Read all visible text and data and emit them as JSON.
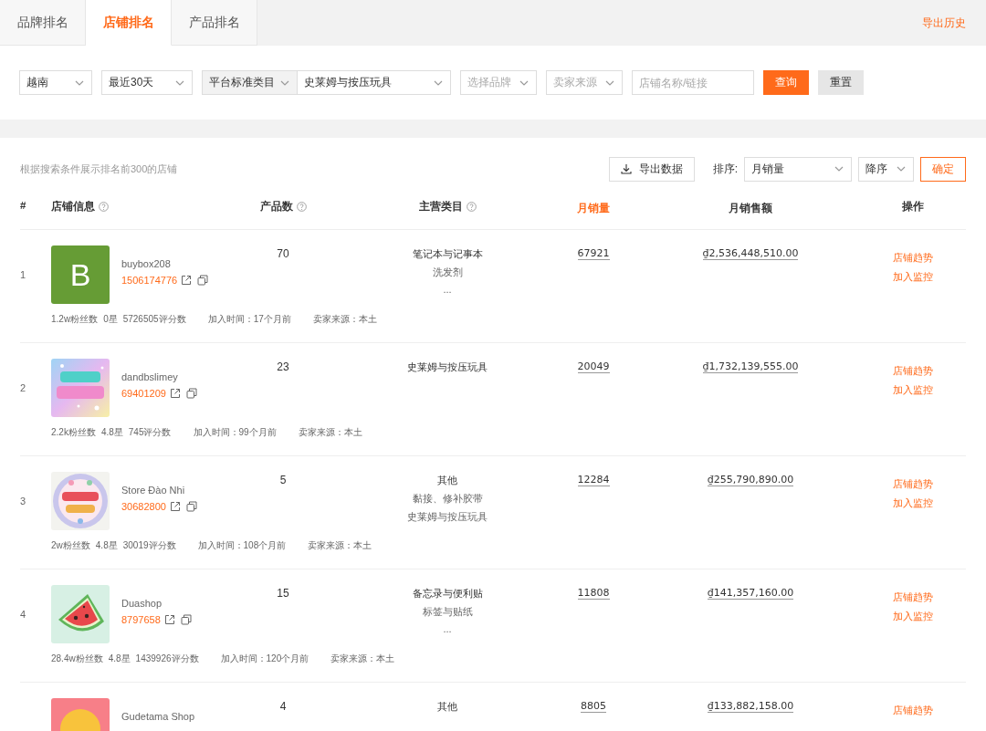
{
  "tabs": [
    {
      "label": "品牌排名",
      "selected": false
    },
    {
      "label": "店铺排名",
      "selected": true
    },
    {
      "label": "产品排名",
      "selected": false
    }
  ],
  "export_history": "导出历史",
  "filters": [
    {
      "kind": "select",
      "value": "越南"
    },
    {
      "kind": "select",
      "value": "最近30天"
    },
    {
      "kind": "category",
      "label": "平台标准类目",
      "value": "史莱姆与按压玩具"
    },
    {
      "kind": "select",
      "placeholder": "选择品牌"
    },
    {
      "kind": "select",
      "placeholder": "卖家来源"
    },
    {
      "kind": "input",
      "placeholder": "店铺名称/链接"
    },
    {
      "kind": "primary",
      "label": "查询"
    },
    {
      "kind": "default",
      "label": "重置"
    }
  ],
  "summary": "根据搜索条件展示排名前300的店铺",
  "export_button": "导出数据",
  "sort": {
    "label": "排序:",
    "field": "月销量",
    "order": "降序",
    "confirm": "确定"
  },
  "columns": [
    {
      "label": "#",
      "help": false,
      "sorted": false
    },
    {
      "label": "店铺信息",
      "help": true,
      "sorted": false
    },
    {
      "label": "产品数",
      "help": true,
      "sorted": false
    },
    {
      "label": "主营类目",
      "help": true,
      "sorted": false
    },
    {
      "label": "月销量",
      "help": false,
      "sorted": true
    },
    {
      "label": "月销售额",
      "help": false,
      "sorted": false
    },
    {
      "label": "操作",
      "help": false,
      "sorted": false
    }
  ],
  "rows": [
    {
      "rank": "1",
      "avatar": {
        "kind": "letter",
        "letter": "B",
        "color": "#669c35"
      },
      "name": "buybox208",
      "id": "1506174776",
      "products": "70",
      "categories": [
        "笔记本与记事本",
        "洗发剂",
        "..."
      ],
      "monthly_sales": "67921",
      "monthly_revenue": "₫2,536,448,510.00",
      "stats": [
        "1.2w粉丝数",
        "0星",
        "5726505评分数",
        "加入时间：17个月前",
        "卖家来源：本土"
      ],
      "actions": [
        "店铺趋势",
        "加入监控"
      ]
    },
    {
      "rank": "2",
      "avatar": {
        "kind": "picture"
      },
      "name": "dandbslimey",
      "id": "69401209",
      "products": "23",
      "categories": [
        "史莱姆与按压玩具"
      ],
      "monthly_sales": "20049",
      "monthly_revenue": "₫1,732,139,555.00",
      "stats": [
        "2.2k粉丝数",
        "4.8星",
        "745评分数",
        "加入时间：99个月前",
        "卖家来源：本土"
      ],
      "actions": [
        "店铺趋势",
        "加入监控"
      ]
    },
    {
      "rank": "3",
      "avatar": {
        "kind": "picture"
      },
      "name": "Store Đào Nhi",
      "id": "30682800",
      "products": "5",
      "categories": [
        "其他",
        "黏接、修补胶带",
        "史莱姆与按压玩具"
      ],
      "monthly_sales": "12284",
      "monthly_revenue": "₫255,790,890.00",
      "stats": [
        "2w粉丝数",
        "4.8星",
        "30019评分数",
        "加入时间：108个月前",
        "卖家来源：本土"
      ],
      "actions": [
        "店铺趋势",
        "加入监控"
      ]
    },
    {
      "rank": "4",
      "avatar": {
        "kind": "picture"
      },
      "name": "Duashop",
      "id": "8797658",
      "products": "15",
      "categories": [
        "备忘录与便利贴",
        "标签与贴纸",
        "..."
      ],
      "monthly_sales": "11808",
      "monthly_revenue": "₫141,357,160.00",
      "stats": [
        "28.4w粉丝数",
        "4.8星",
        "1439926评分数",
        "加入时间：120个月前",
        "卖家来源：本土"
      ],
      "actions": [
        "店铺趋势",
        "加入监控"
      ]
    },
    {
      "avatar": {
        "kind": "picture"
      },
      "name": "Gudetama Shop",
      "products": "4",
      "categories": [
        "其他"
      ],
      "monthly_sales": "8805",
      "monthly_revenue": "₫133,882,158.00",
      "actions": [
        "店铺趋势"
      ]
    }
  ]
}
